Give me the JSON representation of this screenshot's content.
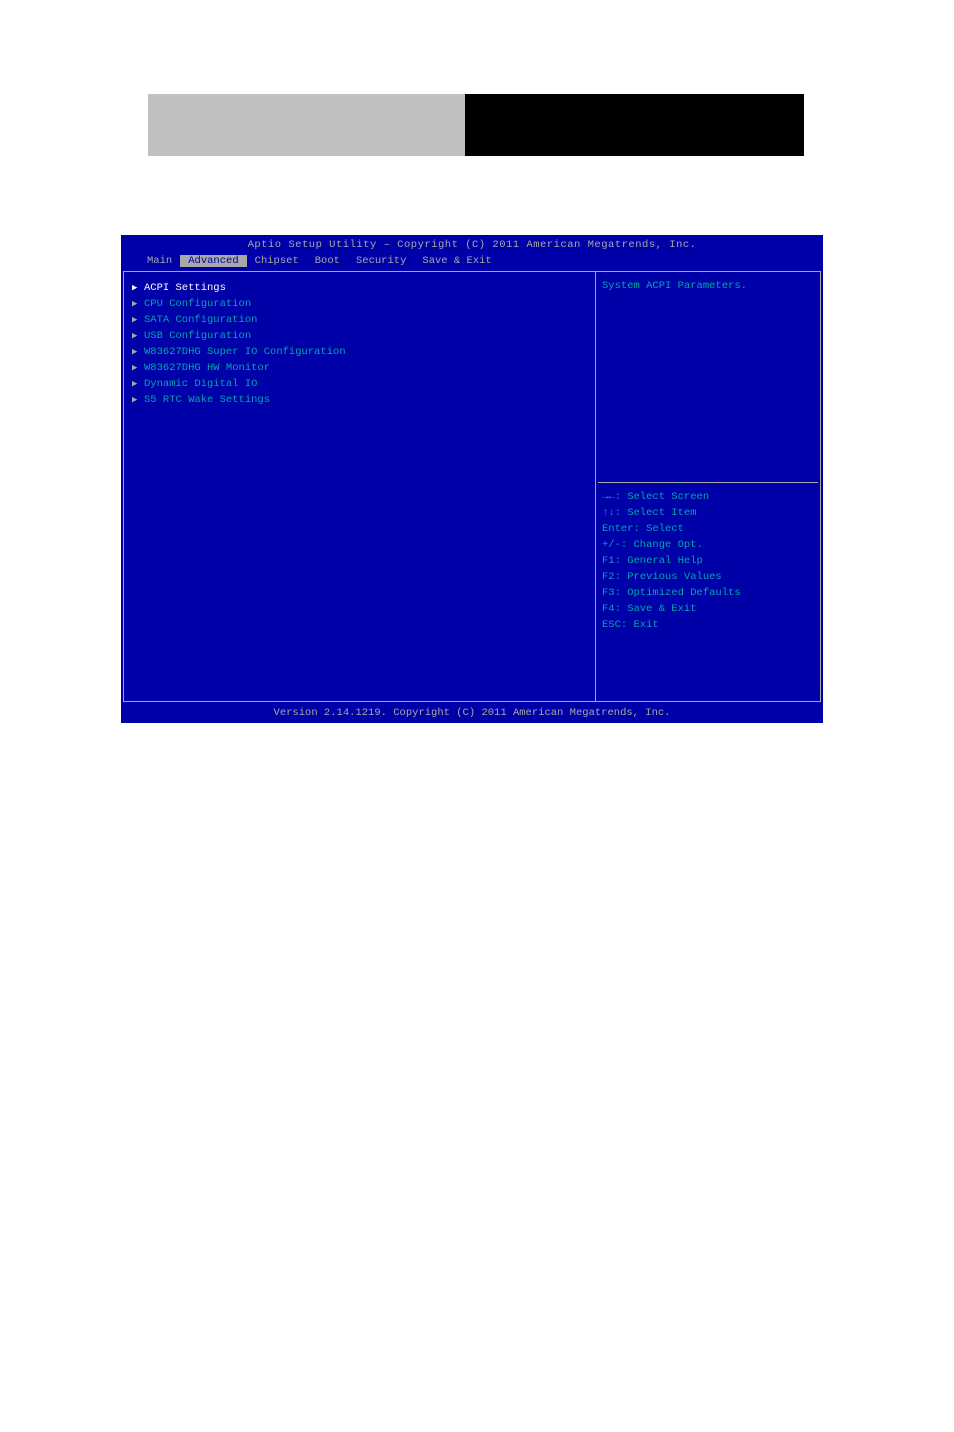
{
  "header": {
    "title": "Aptio Setup Utility – Copyright (C) 2011 American Megatrends, Inc."
  },
  "tabs": {
    "items": [
      {
        "label": "Main"
      },
      {
        "label": "Advanced"
      },
      {
        "label": "Chipset"
      },
      {
        "label": "Boot"
      },
      {
        "label": "Security"
      },
      {
        "label": "Save & Exit"
      }
    ],
    "active_index": 1
  },
  "menu": {
    "items": [
      {
        "label": "ACPI Settings",
        "selected": true
      },
      {
        "label": "CPU Configuration",
        "selected": false
      },
      {
        "label": "SATA Configuration",
        "selected": false
      },
      {
        "label": "USB Configuration",
        "selected": false
      },
      {
        "label": "W83627DHG Super IO Configuration",
        "selected": false
      },
      {
        "label": "W83627DHG HW Monitor",
        "selected": false
      },
      {
        "label": "Dynamic Digital IO",
        "selected": false
      },
      {
        "label": "S5 RTC Wake Settings",
        "selected": false
      }
    ]
  },
  "help": {
    "description": "System ACPI Parameters."
  },
  "nav": {
    "lines": [
      "→←: Select Screen",
      "↑↓: Select Item",
      "Enter: Select",
      "+/-: Change Opt.",
      "F1: General Help",
      "F2: Previous Values",
      "F3: Optimized Defaults",
      "F4: Save & Exit",
      "ESC: Exit"
    ]
  },
  "footer": {
    "text": "Version 2.14.1219. Copyright (C) 2011 American Megatrends, Inc."
  }
}
